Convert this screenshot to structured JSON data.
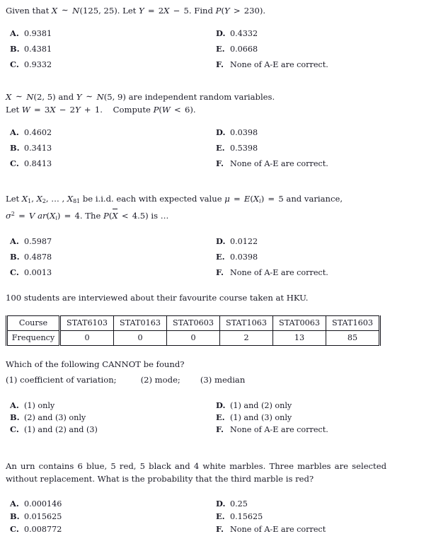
{
  "document": {
    "type": "statistics-exam-multiple-choice"
  },
  "questions": [
    {
      "id": "q1",
      "stem_lines": [
        "Given that X ~ N(125, 25). Let Y = 2X − 5. Find P(Y > 230)."
      ],
      "options": [
        {
          "label": "A.",
          "text": "0.9381"
        },
        {
          "label": "B.",
          "text": "0.4381"
        },
        {
          "label": "C.",
          "text": "0.9332"
        },
        {
          "label": "D.",
          "text": "0.4332"
        },
        {
          "label": "E.",
          "text": "0.0668"
        },
        {
          "label": "F.",
          "text": "None of A-E are correct."
        }
      ]
    },
    {
      "id": "q2",
      "stem_lines": [
        "X ~ N(2, 5) and Y ~ N(5, 9) are independent random variables.",
        "Let W = 3X − 2Y + 1.    Compute P(W < 6)."
      ],
      "options": [
        {
          "label": "A.",
          "text": "0.4602"
        },
        {
          "label": "B.",
          "text": "0.3413"
        },
        {
          "label": "C.",
          "text": "0.8413"
        },
        {
          "label": "D.",
          "text": "0.0398"
        },
        {
          "label": "E.",
          "text": "0.5398"
        },
        {
          "label": "F.",
          "text": "None of A-E are correct."
        }
      ]
    },
    {
      "id": "q3",
      "stem_lines": [
        "Let X1, X2, ..., X81 be i.i.d. each with expected value μ = E(Xi) = 5 and variance,",
        "σ² = Var(Xi) = 4. The P(X̄ < 4.5) is ..."
      ],
      "options": [
        {
          "label": "A.",
          "text": "0.5987"
        },
        {
          "label": "B.",
          "text": "0.4878"
        },
        {
          "label": "C.",
          "text": "0.0013"
        },
        {
          "label": "D.",
          "text": "0.0122"
        },
        {
          "label": "E.",
          "text": "0.0398"
        },
        {
          "label": "F.",
          "text": "None of A-E are correct."
        }
      ]
    },
    {
      "id": "q4",
      "intro": "100 students are interviewed about their favourite course taken at HKU.",
      "question_line": "Which of the following CANNOT be found?",
      "sublist": [
        "(1) coefficient of variation;",
        "(2) mode;",
        "(3) median"
      ],
      "table": {
        "row_headers": [
          "Course",
          "Frequency"
        ],
        "courses": [
          "STAT6103",
          "STAT0163",
          "STAT0603",
          "STAT1063",
          "STAT0063",
          "STAT1603"
        ],
        "frequencies": [
          "0",
          "0",
          "0",
          "2",
          "13",
          "85"
        ]
      },
      "options": [
        {
          "label": "A.",
          "text": "(1) only"
        },
        {
          "label": "B.",
          "text": "(2) and (3) only"
        },
        {
          "label": "C.",
          "text": "(1) and (2) and (3)"
        },
        {
          "label": "D.",
          "text": "(1) and (2) only"
        },
        {
          "label": "E.",
          "text": "(1) and (3) only"
        },
        {
          "label": "F.",
          "text": "None of A-E are correct."
        }
      ]
    },
    {
      "id": "q5",
      "stem_lines": [
        "An urn contains 6 blue, 5 red, 5 black and 4 white marbles.  Three marbles are selected without replacement. What is the probability that the third marble is red?"
      ],
      "options": [
        {
          "label": "A.",
          "text": "0.000146"
        },
        {
          "label": "B.",
          "text": "0.015625"
        },
        {
          "label": "C.",
          "text": "0.008772"
        },
        {
          "label": "D.",
          "text": "0.25"
        },
        {
          "label": "E.",
          "text": "0.15625"
        },
        {
          "label": "F.",
          "text": "None of A-E are correct"
        }
      ]
    }
  ],
  "colors": {
    "text": "#1a1a26",
    "rule": "#111118",
    "background": "#ffffff"
  }
}
